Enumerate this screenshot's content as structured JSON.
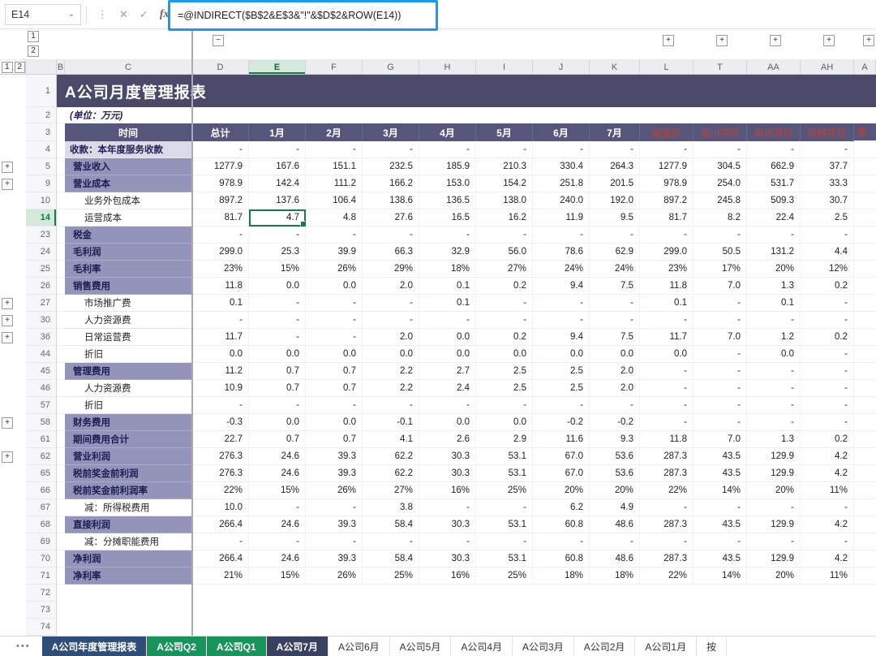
{
  "formula_bar": {
    "name_box": "E14",
    "more_icon": "⋮",
    "cancel_icon": "✕",
    "confirm_icon": "✓",
    "fx_label": "fx",
    "formula": "=@INDIRECT($B$2&E$3&\"!\"&$D$2&ROW(E14))"
  },
  "outline": {
    "col_levels": [
      "1",
      "2"
    ],
    "row_levels": [
      "1",
      "2"
    ],
    "collapse_label": "−",
    "expand_label": "+"
  },
  "grid": {
    "column_letters": [
      "B",
      "C",
      "D",
      "E",
      "F",
      "G",
      "H",
      "I",
      "J",
      "K",
      "L",
      "T",
      "AA",
      "AH",
      "A"
    ],
    "selected_column": "E",
    "selected_row": "14",
    "title": "A公司月度管理报表",
    "unit_note": "(单位：万元)",
    "header_row": {
      "time_label": "时间",
      "cols": [
        "总计",
        "1月",
        "2月",
        "3月",
        "4月",
        "5月",
        "6月",
        "7月",
        "运营部",
        "南山项目",
        "海岛项目",
        "雨林项目",
        "紫"
      ]
    },
    "collapsed_row_buttons": [
      "5",
      "9",
      "27",
      "30",
      "36",
      "58",
      "62"
    ],
    "data_rows": [
      {
        "num": "4",
        "label": "收款：本年度服务收款",
        "style": "sec",
        "values": [
          "-",
          "-",
          "-",
          "-",
          "-",
          "-",
          "-",
          "-",
          "-",
          "-",
          "-",
          "-"
        ]
      },
      {
        "num": "5",
        "label": "营业收入",
        "style": "cat",
        "values": [
          "1277.9",
          "167.6",
          "151.1",
          "232.5",
          "185.9",
          "210.3",
          "330.4",
          "264.3",
          "1277.9",
          "304.5",
          "662.9",
          "37.7"
        ]
      },
      {
        "num": "9",
        "label": "营业成本",
        "style": "cat",
        "values": [
          "978.9",
          "142.4",
          "111.2",
          "166.2",
          "153.0",
          "154.2",
          "251.8",
          "201.5",
          "978.9",
          "254.0",
          "531.7",
          "33.3"
        ]
      },
      {
        "num": "10",
        "label": "业务外包成本",
        "style": "sub",
        "values": [
          "897.2",
          "137.6",
          "106.4",
          "138.6",
          "136.5",
          "138.0",
          "240.0",
          "192.0",
          "897.2",
          "245.8",
          "509.3",
          "30.7"
        ]
      },
      {
        "num": "14",
        "label": "运营成本",
        "style": "sub",
        "values": [
          "81.7",
          "4.7",
          "4.8",
          "27.6",
          "16.5",
          "16.2",
          "11.9",
          "9.5",
          "81.7",
          "8.2",
          "22.4",
          "2.5"
        ]
      },
      {
        "num": "23",
        "label": "税金",
        "style": "cat",
        "values": [
          "-",
          "-",
          "-",
          "-",
          "-",
          "-",
          "-",
          "-",
          "-",
          "-",
          "-",
          "-"
        ]
      },
      {
        "num": "24",
        "label": "毛利润",
        "style": "cat",
        "values": [
          "299.0",
          "25.3",
          "39.9",
          "66.3",
          "32.9",
          "56.0",
          "78.6",
          "62.9",
          "299.0",
          "50.5",
          "131.2",
          "4.4"
        ]
      },
      {
        "num": "25",
        "label": "毛利率",
        "style": "cat",
        "values": [
          "23%",
          "15%",
          "26%",
          "29%",
          "18%",
          "27%",
          "24%",
          "24%",
          "23%",
          "17%",
          "20%",
          "12%"
        ]
      },
      {
        "num": "26",
        "label": "销售费用",
        "style": "cat",
        "values": [
          "11.8",
          "0.0",
          "0.0",
          "2.0",
          "0.1",
          "0.2",
          "9.4",
          "7.5",
          "11.8",
          "7.0",
          "1.3",
          "0.2"
        ]
      },
      {
        "num": "27",
        "label": "市场推广费",
        "style": "sub",
        "values": [
          "0.1",
          "-",
          "-",
          "-",
          "0.1",
          "-",
          "-",
          "-",
          "0.1",
          "-",
          "0.1",
          "-"
        ]
      },
      {
        "num": "30",
        "label": "人力资源费",
        "style": "sub",
        "values": [
          "-",
          "-",
          "-",
          "-",
          "-",
          "-",
          "-",
          "-",
          "-",
          "-",
          "-",
          "-"
        ]
      },
      {
        "num": "36",
        "label": "日常运营费",
        "style": "sub",
        "values": [
          "11.7",
          "-",
          "-",
          "2.0",
          "0.0",
          "0.2",
          "9.4",
          "7.5",
          "11.7",
          "7.0",
          "1.2",
          "0.2"
        ]
      },
      {
        "num": "44",
        "label": "折旧",
        "style": "sub",
        "values": [
          "0.0",
          "0.0",
          "0.0",
          "0.0",
          "0.0",
          "0.0",
          "0.0",
          "0.0",
          "0.0",
          "-",
          "0.0",
          "-"
        ]
      },
      {
        "num": "45",
        "label": "管理费用",
        "style": "cat",
        "values": [
          "11.2",
          "0.7",
          "0.7",
          "2.2",
          "2.7",
          "2.5",
          "2.5",
          "2.0",
          "-",
          "-",
          "-",
          "-"
        ]
      },
      {
        "num": "46",
        "label": "人力资源费",
        "style": "sub",
        "values": [
          "10.9",
          "0.7",
          "0.7",
          "2.2",
          "2.4",
          "2.5",
          "2.5",
          "2.0",
          "-",
          "-",
          "-",
          "-"
        ]
      },
      {
        "num": "57",
        "label": "折旧",
        "style": "sub",
        "values": [
          "-",
          "-",
          "-",
          "-",
          "-",
          "-",
          "-",
          "-",
          "-",
          "-",
          "-",
          "-"
        ]
      },
      {
        "num": "58",
        "label": "财务费用",
        "style": "cat",
        "values": [
          "-0.3",
          "0.0",
          "0.0",
          "-0.1",
          "0.0",
          "0.0",
          "-0.2",
          "-0.2",
          "-",
          "-",
          "-",
          "-"
        ]
      },
      {
        "num": "61",
        "label": "期间费用合计",
        "style": "cat",
        "values": [
          "22.7",
          "0.7",
          "0.7",
          "4.1",
          "2.6",
          "2.9",
          "11.6",
          "9.3",
          "11.8",
          "7.0",
          "1.3",
          "0.2"
        ]
      },
      {
        "num": "62",
        "label": "营业利润",
        "style": "cat",
        "values": [
          "276.3",
          "24.6",
          "39.3",
          "62.2",
          "30.3",
          "53.1",
          "67.0",
          "53.6",
          "287.3",
          "43.5",
          "129.9",
          "4.2"
        ]
      },
      {
        "num": "65",
        "label": "税前奖金前利润",
        "style": "cat",
        "values": [
          "276.3",
          "24.6",
          "39.3",
          "62.2",
          "30.3",
          "53.1",
          "67.0",
          "53.6",
          "287.3",
          "43.5",
          "129.9",
          "4.2"
        ]
      },
      {
        "num": "66",
        "label": "税前奖金前利润率",
        "style": "cat",
        "values": [
          "22%",
          "15%",
          "26%",
          "27%",
          "16%",
          "25%",
          "20%",
          "20%",
          "22%",
          "14%",
          "20%",
          "11%"
        ]
      },
      {
        "num": "67",
        "label": "减：所得税费用",
        "style": "sub",
        "values": [
          "10.0",
          "-",
          "-",
          "3.8",
          "-",
          "-",
          "6.2",
          "4.9",
          "-",
          "-",
          "-",
          "-"
        ]
      },
      {
        "num": "68",
        "label": "直接利润",
        "style": "cat",
        "values": [
          "266.4",
          "24.6",
          "39.3",
          "58.4",
          "30.3",
          "53.1",
          "60.8",
          "48.6",
          "287.3",
          "43.5",
          "129.9",
          "4.2"
        ]
      },
      {
        "num": "69",
        "label": "减：分摊职能费用",
        "style": "sub",
        "values": [
          "-",
          "-",
          "-",
          "-",
          "-",
          "-",
          "-",
          "-",
          "-",
          "-",
          "-",
          "-"
        ]
      },
      {
        "num": "70",
        "label": "净利润",
        "style": "cat",
        "values": [
          "266.4",
          "24.6",
          "39.3",
          "58.4",
          "30.3",
          "53.1",
          "60.8",
          "48.6",
          "287.3",
          "43.5",
          "129.9",
          "4.2"
        ]
      },
      {
        "num": "71",
        "label": "净利率",
        "style": "cat",
        "values": [
          "21%",
          "15%",
          "26%",
          "25%",
          "16%",
          "25%",
          "18%",
          "18%",
          "22%",
          "14%",
          "20%",
          "11%"
        ]
      },
      {
        "num": "72",
        "label": "",
        "style": "emp",
        "values": [
          "",
          "",
          "",
          "",
          "",
          "",
          "",
          "",
          "",
          "",
          "",
          ""
        ]
      },
      {
        "num": "73",
        "label": "",
        "style": "emp",
        "values": [
          "",
          "",
          "",
          "",
          "",
          "",
          "",
          "",
          "",
          "",
          "",
          ""
        ]
      },
      {
        "num": "74",
        "label": "",
        "style": "emp",
        "values": [
          "",
          "",
          "",
          "",
          "",
          "",
          "",
          "",
          "",
          "",
          "",
          ""
        ]
      }
    ]
  },
  "sheet_tabs": {
    "more_label": "•••",
    "tabs": [
      {
        "label": "A公司年度管理报表",
        "color": "#2e4d78",
        "text": "#ffffff"
      },
      {
        "label": "A公司Q2",
        "color": "#17935c",
        "text": "#ffffff"
      },
      {
        "label": "A公司Q1",
        "color": "#17935c",
        "text": "#ffffff"
      },
      {
        "label": "A公司7月",
        "color": "#3a4060",
        "text": "#ffffff"
      },
      {
        "label": "A公司6月",
        "color": "#ffffff",
        "text": "#333333"
      },
      {
        "label": "A公司5月",
        "color": "#ffffff",
        "text": "#333333"
      },
      {
        "label": "A公司4月",
        "color": "#ffffff",
        "text": "#333333"
      },
      {
        "label": "A公司3月",
        "color": "#ffffff",
        "text": "#333333"
      },
      {
        "label": "A公司2月",
        "color": "#ffffff",
        "text": "#333333"
      },
      {
        "label": "A公司1月",
        "color": "#ffffff",
        "text": "#333333"
      },
      {
        "label": "按",
        "color": "#ffffff",
        "text": "#333333"
      }
    ]
  }
}
